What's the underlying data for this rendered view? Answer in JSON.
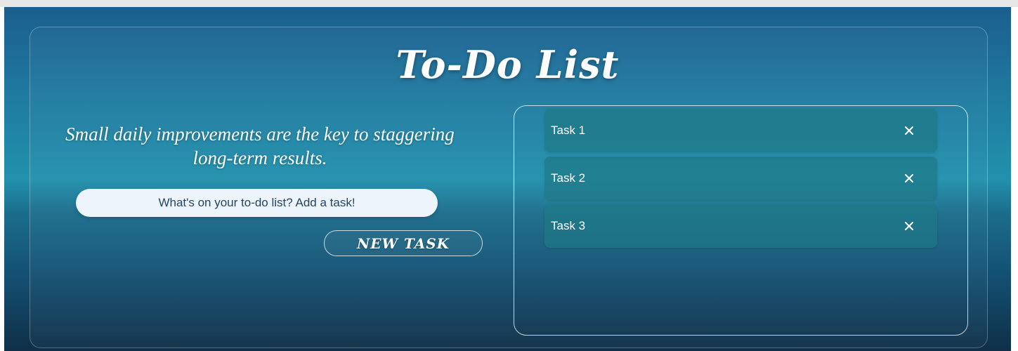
{
  "app": {
    "title": "To-Do List",
    "quote": "Small daily improvements are the key to staggering long-term results."
  },
  "input": {
    "value": "",
    "placeholder": "What's on your to-do list? Add a task!"
  },
  "new_task_button": {
    "label": "NEW TASK"
  },
  "tasks": [
    {
      "label": "Task 1",
      "icon": "close-icon"
    },
    {
      "label": "Task 2",
      "icon": "close-icon"
    },
    {
      "label": "Task 3",
      "icon": "close-icon"
    }
  ],
  "colors": {
    "gradient_top": "#1b5e8e",
    "gradient_mid": "#2291ad",
    "gradient_bottom": "#0f2f47",
    "task_bg": "#1e7887",
    "input_bg": "#eef4fb",
    "text": "#ffffff"
  }
}
